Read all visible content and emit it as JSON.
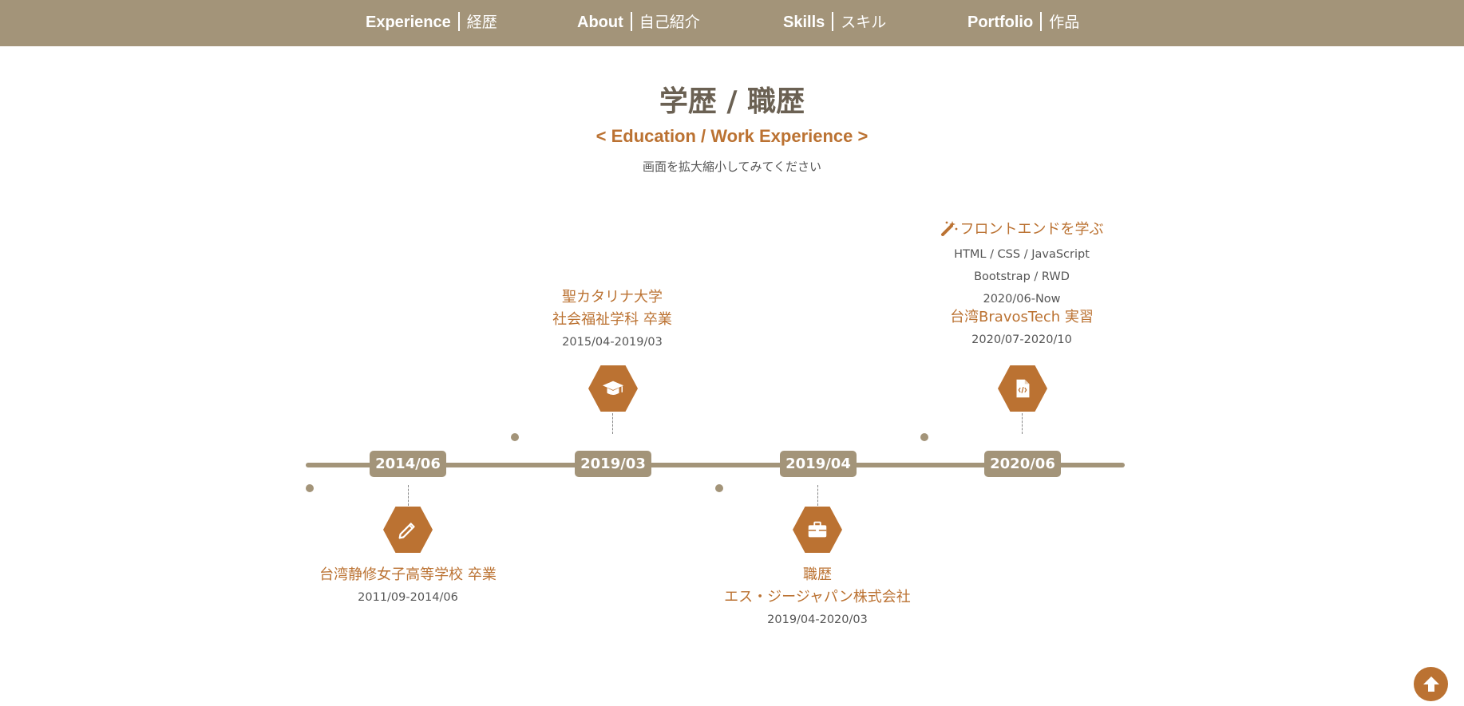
{
  "nav": {
    "items": [
      {
        "en": "Experience",
        "jp": "経歴"
      },
      {
        "en": "About",
        "jp": "自己紹介"
      },
      {
        "en": "Skills",
        "jp": "スキル"
      },
      {
        "en": "Portfolio",
        "jp": "作品"
      }
    ]
  },
  "header": {
    "title": "学歴 / 職歴",
    "subtitle": "< Education / Work Experience >",
    "hint": "画面を拡大縮小してみてください"
  },
  "timeline": {
    "dates": [
      "2014/06",
      "2019/03",
      "2019/04",
      "2020/06"
    ],
    "highschool": {
      "icon": "pencil-icon",
      "name": "台湾静修女子高等学校 卒業",
      "period": "2011/09-2014/06"
    },
    "university": {
      "icon": "graduation-cap-icon",
      "name_line1": "聖カタリナ大学",
      "name_line2": "社会福祉学科 卒業",
      "period": "2015/04-2019/03"
    },
    "job": {
      "icon": "briefcase-icon",
      "title": "職歴",
      "company": "エス・ジージャパン株式会社",
      "period": "2019/04-2020/03"
    },
    "frontend": {
      "icon": "code-file-icon",
      "heading_icon": "magic-wand-icon",
      "heading": "フロントエンドを学ぶ",
      "skills1": "HTML / CSS / JavaScript",
      "skills2": "Bootstrap / RWD",
      "period1": "2020/06-Now",
      "internship": "台湾BravosTech 実習",
      "period2": "2020/07-2020/10"
    }
  },
  "back_to_top": {
    "icon": "arrow-up-icon"
  },
  "colors": {
    "nav": "#a39479",
    "accent": "#bb7232",
    "title": "#6b6153"
  }
}
